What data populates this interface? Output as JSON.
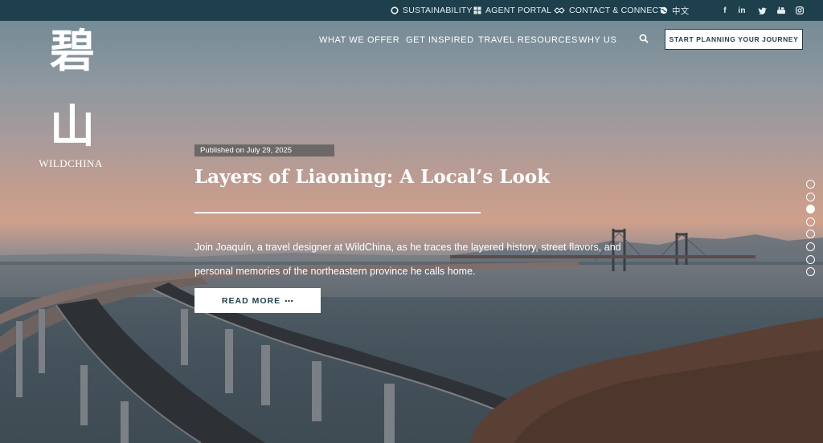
{
  "topbar": {
    "sustainability": "SUSTAINABILITY",
    "agent_portal": "AGENT PORTAL",
    "contact": "CONTACT & CONNECT",
    "language": "中文",
    "social_icons": [
      "facebook-icon",
      "linkedin-icon",
      "twitter-icon",
      "youtube-icon",
      "instagram-icon"
    ]
  },
  "logo": {
    "glyph_1": "碧",
    "glyph_2": "山",
    "wordmark": "WILDCHINA"
  },
  "nav": {
    "items": [
      "WHAT WE OFFER",
      "GET INSPIRED",
      "TRAVEL RESOURCES",
      "WHY US"
    ],
    "cta": "START PLANNING YOUR JOURNEY"
  },
  "article": {
    "published": "Published on July 29, 2025",
    "title": "Layers of Liaoning: A Local’s Look",
    "excerpt": "Join Joaquín, a travel designer at WildChina, as he traces the layered history, street flavors, and personal memories of the northeastern province he calls home.",
    "read_more": "READ MORE"
  },
  "slider": {
    "total": 8,
    "active_index": 2
  },
  "colors": {
    "brand_dark": "#1e3f4c",
    "white": "#ffffff"
  }
}
